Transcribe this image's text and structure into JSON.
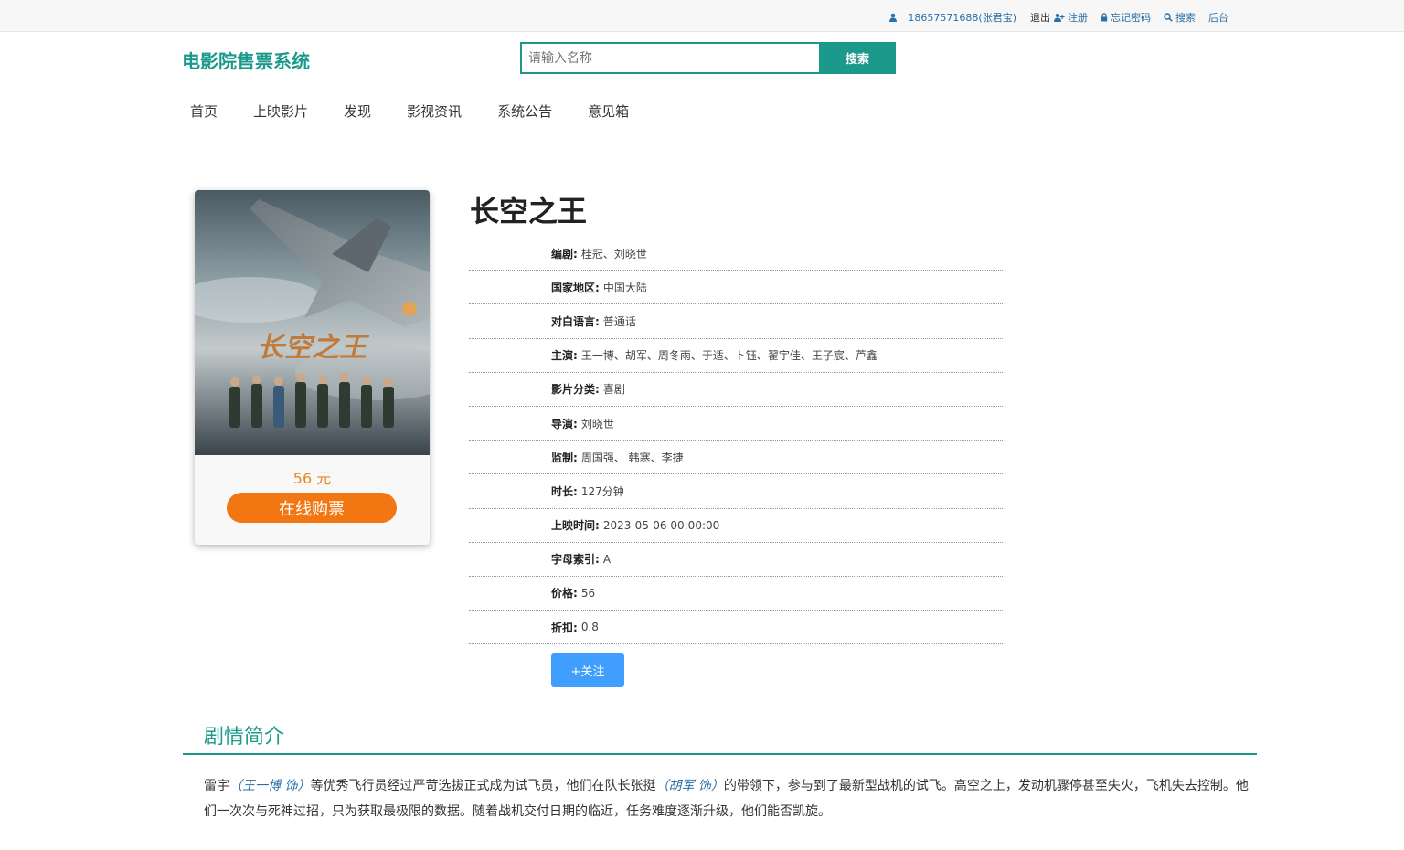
{
  "topbar": {
    "user": "18657571688(张君宝)",
    "logout": "退出",
    "register": "注册",
    "forgot": "忘记密码",
    "search": "搜索",
    "admin": "后台"
  },
  "header": {
    "logo": "电影院售票系统",
    "search_placeholder": "请输入名称",
    "search_button": "搜索"
  },
  "nav": [
    "首页",
    "上映影片",
    "发现",
    "影视资讯",
    "系统公告",
    "意见箱"
  ],
  "movie": {
    "title": "长空之王",
    "price_label": "56 元",
    "buy_label": "在线购票",
    "follow_label": "+关注",
    "details": [
      {
        "key": "编剧:",
        "value": "桂冠、刘晓世"
      },
      {
        "key": "国家地区:",
        "value": "中国大陆"
      },
      {
        "key": "对白语言:",
        "value": "普通话"
      },
      {
        "key": "主演:",
        "value": "王一博、胡军、周冬雨、于适、卜钰、翟宇佳、王子宸、芦鑫"
      },
      {
        "key": "影片分类:",
        "value": "喜剧"
      },
      {
        "key": "导演:",
        "value": "刘晓世"
      },
      {
        "key": "监制:",
        "value": "周国强、 韩寒、李捷"
      },
      {
        "key": "时长:",
        "value": "127分钟"
      },
      {
        "key": "上映时间:",
        "value": "2023-05-06 00:00:00"
      },
      {
        "key": "字母索引:",
        "value": "A"
      },
      {
        "key": "价格:",
        "value": "56"
      },
      {
        "key": "折扣:",
        "value": "0.8"
      }
    ]
  },
  "synopsis": {
    "title": "剧情简介",
    "p1": "雷宇",
    "actor1": "（王一博 饰）",
    "p2": "等优秀飞行员经过严苛选拔正式成为试飞员，他们在队长张挺",
    "actor2": "（胡军 饰）",
    "p3": "的带领下，参与到了最新型战机的试飞。高空之上，发动机骤停甚至失火，飞机失去控制。他们一次次与死神过招，只为获取最极限的数据。随着战机交付日期的临近，任务难度逐渐升级，他们能否凯旋。"
  },
  "colors": {
    "brand": "#1b9a8c",
    "buy": "#f27611",
    "price": "#e38a1e",
    "follow": "#409eff",
    "link": "#2a6fa8"
  }
}
